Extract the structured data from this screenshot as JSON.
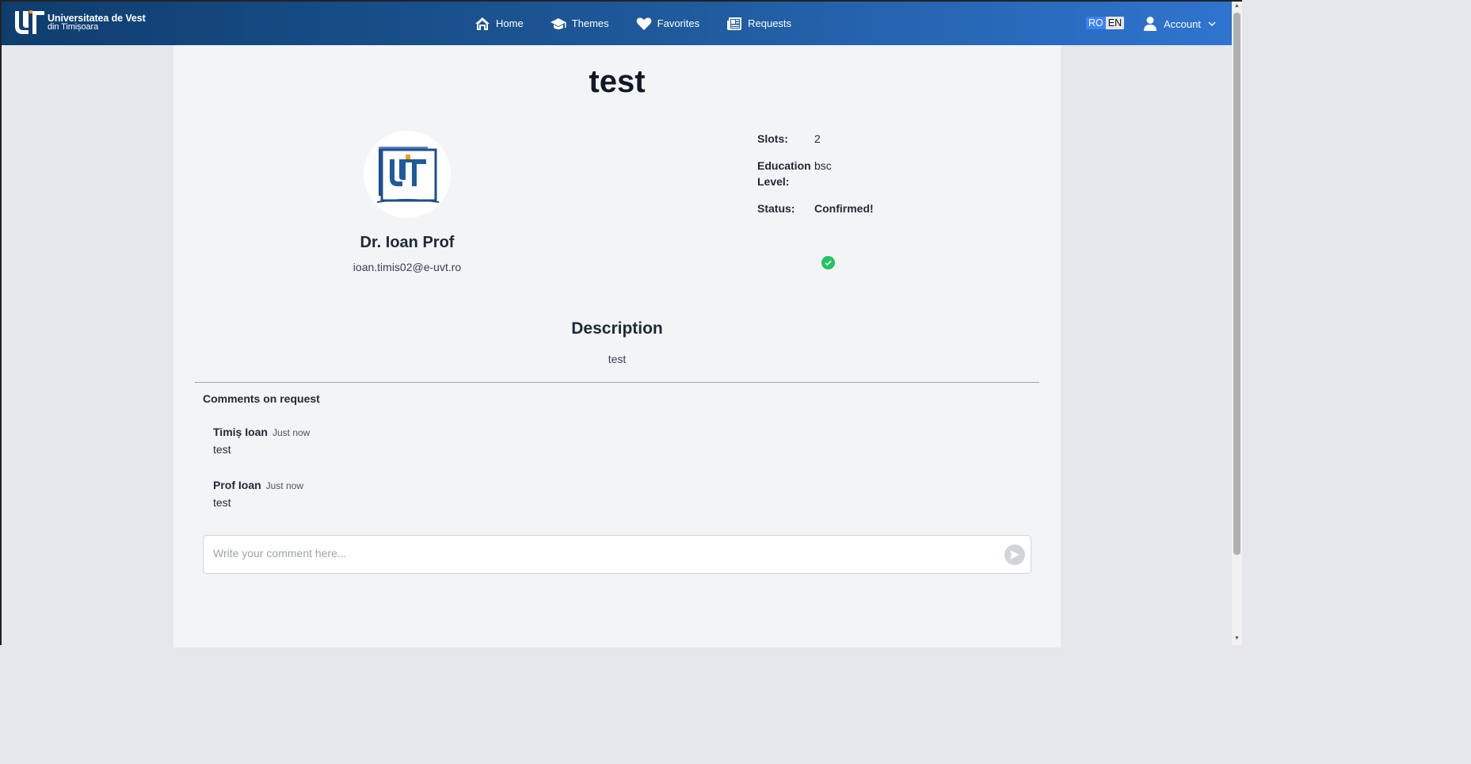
{
  "brand": {
    "line1": "Universitatea de Vest",
    "line2": "din Timișoara"
  },
  "nav": {
    "home": "Home",
    "themes": "Themes",
    "favorites": "Favorites",
    "requests": "Requests"
  },
  "language": {
    "ro": "RO",
    "en": "EN",
    "active": "RO"
  },
  "account": {
    "label": "Account"
  },
  "request": {
    "title": "test",
    "professor_name": "Dr. Ioan Prof",
    "professor_email": "ioan.timis02@e-uvt.ro",
    "slots_label": "Slots:",
    "slots_value": "2",
    "education_label": "Education Level:",
    "education_value": "bsc",
    "status_label": "Status:",
    "status_value": "Confirmed!",
    "status_color": "#22c55e"
  },
  "description": {
    "heading": "Description",
    "text": "test"
  },
  "comments": {
    "heading": "Comments on request",
    "items": [
      {
        "author": "Timiș Ioan",
        "time": "Just now",
        "body": "test"
      },
      {
        "author": "Prof Ioan",
        "time": "Just now",
        "body": "test"
      }
    ],
    "input_placeholder": "Write your comment here...",
    "input_value": ""
  }
}
